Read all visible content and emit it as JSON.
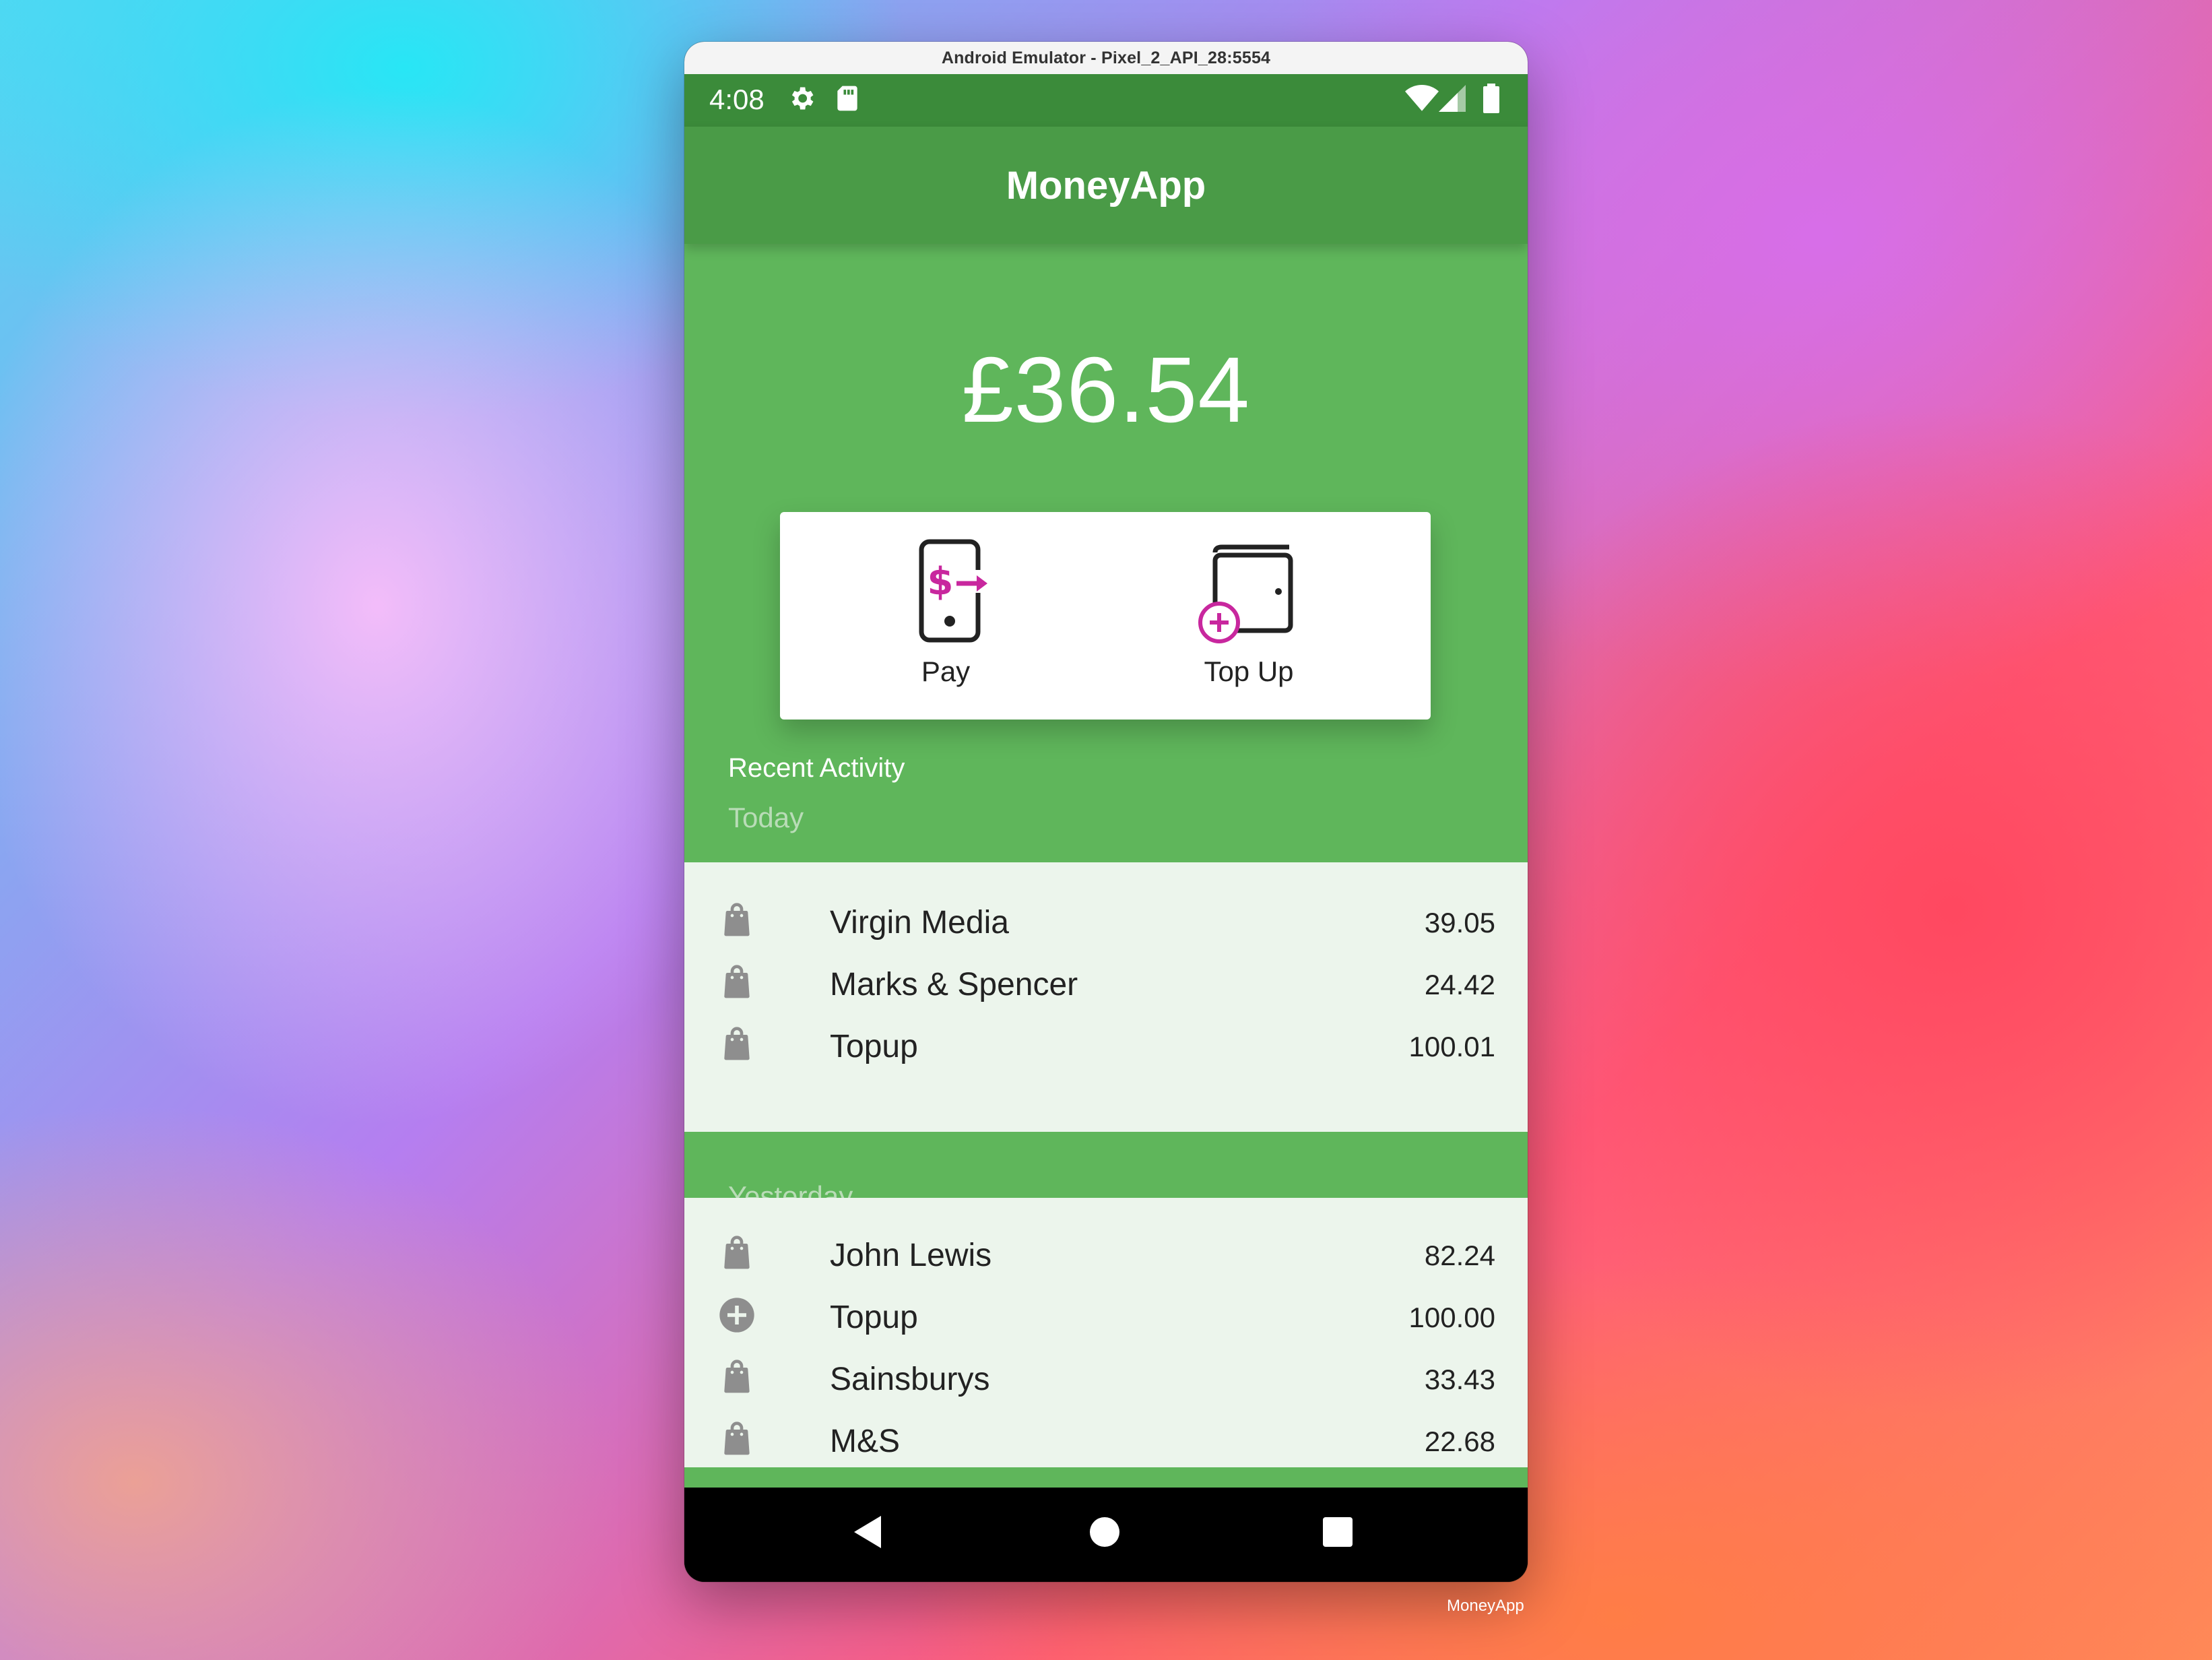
{
  "window": {
    "title": "Android Emulator - Pixel_2_API_28:5554"
  },
  "status": {
    "time": "4:08"
  },
  "app": {
    "title": "MoneyApp",
    "balance": "£36.54"
  },
  "actions": [
    {
      "label": "Pay",
      "icon": "phone-pay-icon"
    },
    {
      "label": "Top Up",
      "icon": "wallet-topup-icon"
    }
  ],
  "activity": {
    "heading": "Recent Activity",
    "groups": [
      {
        "date": "Today",
        "items": [
          {
            "name": "Virgin Media",
            "amount": "39.05",
            "icon": "shopping-bag-icon"
          },
          {
            "name": "Marks & Spencer",
            "amount": "24.42",
            "icon": "shopping-bag-icon"
          },
          {
            "name": "Topup",
            "amount": "100.01",
            "icon": "shopping-bag-icon"
          }
        ]
      },
      {
        "date": "Yesterday",
        "items": [
          {
            "name": "John Lewis",
            "amount": "82.24",
            "icon": "shopping-bag-icon"
          },
          {
            "name": "Topup",
            "amount": "100.00",
            "icon": "add-circle-icon"
          },
          {
            "name": "Sainsburys",
            "amount": "33.43",
            "icon": "shopping-bag-icon"
          },
          {
            "name": "M&S",
            "amount": "22.68",
            "icon": "shopping-bag-icon"
          }
        ]
      }
    ]
  },
  "dock": {
    "label": "MoneyApp"
  },
  "colors": {
    "primary": "#5fb65b",
    "appbar": "#4a9b47",
    "statusbar": "#3b8b3a",
    "accent": "#c8279e",
    "listBg": "#ecf5ec"
  }
}
